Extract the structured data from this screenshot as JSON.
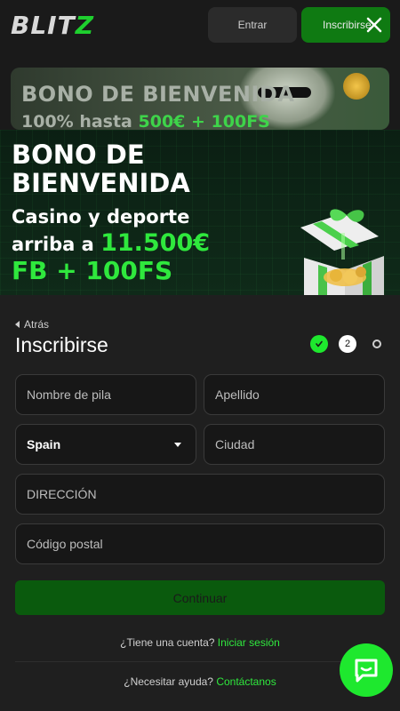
{
  "header": {
    "logo_text": "BLITZ",
    "login_label": "Entrar",
    "register_label": "Inscribirse"
  },
  "background_banner": {
    "title": "BONO DE BIENVENIDA",
    "subtitle_prefix": "100% hasta",
    "subtitle_highlight": "500€ + 100FS"
  },
  "promo": {
    "title": "BONO DE BIENVENIDA",
    "line1": "Casino y deporte",
    "line2_prefix": "arriba a",
    "line2_highlight": "11.500€",
    "line3": "FB + 100FS"
  },
  "form": {
    "back_label": "Atrás",
    "title": "Inscribirse",
    "steps": {
      "step2": "2"
    },
    "first_name_placeholder": "Nombre de pila",
    "last_name_placeholder": "Apellido",
    "country_value": "Spain",
    "city_placeholder": "Ciudad",
    "address_placeholder": "DIRECCIÓN",
    "postal_placeholder": "Código postal",
    "continue_label": "Continuar",
    "account_question": "¿Tiene una cuenta?",
    "login_link": "Iniciar sesión",
    "help_question": "¿Necesitar ayuda?",
    "contact_link": "Contáctanos"
  },
  "colors": {
    "accent": "#1ee82e",
    "button_green": "#0f7a12",
    "continue_disabled": "#0a5a0d",
    "panel": "#1f1f1f"
  },
  "icons": [
    "close-icon",
    "check-icon",
    "back-arrow-icon",
    "dropdown-caret-icon",
    "chat-icon"
  ]
}
